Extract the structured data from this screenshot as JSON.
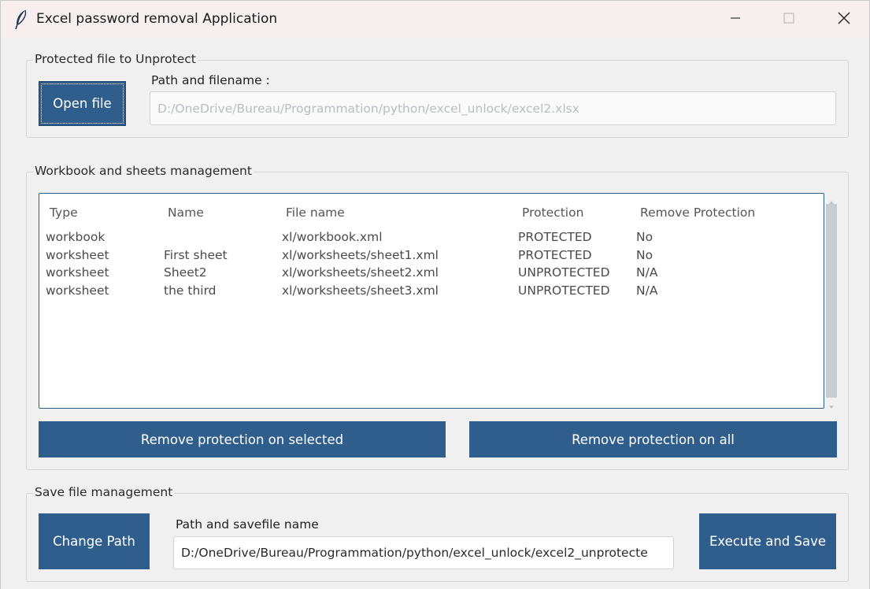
{
  "window": {
    "title": "Excel password removal Application",
    "icon": "feather-icon"
  },
  "protected_group": {
    "legend": "Protected file to Unprotect",
    "open_button": "Open file",
    "path_label": "Path and filename :",
    "path_value": "D:/OneDrive/Bureau/Programmation/python/excel_unlock/excel2.xlsx"
  },
  "workbook_group": {
    "legend": "Workbook and sheets management",
    "columns": [
      "Type",
      "Name",
      "File name",
      "Protection",
      "Remove Protection"
    ],
    "rows": [
      {
        "type": "workbook",
        "name": "",
        "file": "xl/workbook.xml",
        "protection": "PROTECTED",
        "remove": "No"
      },
      {
        "type": "worksheet",
        "name": "First sheet",
        "file": "xl/worksheets/sheet1.xml",
        "protection": "PROTECTED",
        "remove": "No"
      },
      {
        "type": "worksheet",
        "name": "Sheet2",
        "file": "xl/worksheets/sheet2.xml",
        "protection": "UNPROTECTED",
        "remove": "N/A"
      },
      {
        "type": "worksheet",
        "name": "the third",
        "file": "xl/worksheets/sheet3.xml",
        "protection": "UNPROTECTED",
        "remove": "N/A"
      }
    ],
    "remove_selected_button": "Remove protection on selected",
    "remove_all_button": "Remove protection on all"
  },
  "save_group": {
    "legend": "Save file management",
    "change_path_button": "Change Path",
    "path_label": "Path and savefile name",
    "path_value": "D:/OneDrive/Bureau/Programmation/python/excel_unlock/excel2_unprotecte",
    "execute_button": "Execute and Save"
  },
  "colors": {
    "accent": "#2f5e8c",
    "titlebar": "#f7efee",
    "background": "#f0f0f0"
  }
}
